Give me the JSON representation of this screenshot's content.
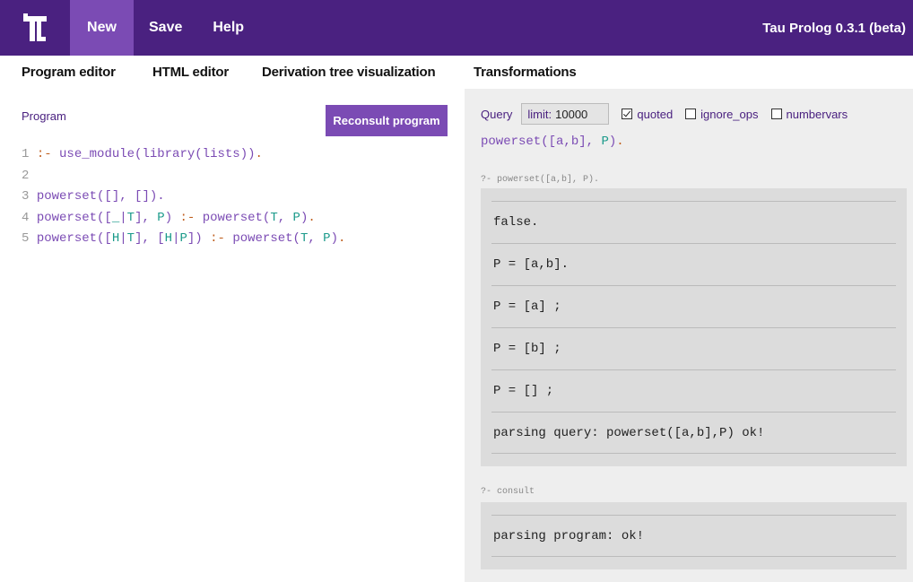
{
  "app": {
    "brand": "Tau Prolog 0.3.1 (beta)",
    "logo_icon": "tau-logo-icon",
    "colors": {
      "header": "#4a2180",
      "accent": "#7b4bb4",
      "variable": "#1a9a8a",
      "operator": "#c06020"
    }
  },
  "menu": {
    "items": [
      {
        "label": "New"
      },
      {
        "label": "Save"
      },
      {
        "label": "Help"
      }
    ]
  },
  "tabs": [
    {
      "label": "Program editor",
      "active": true
    },
    {
      "label": "HTML editor"
    },
    {
      "label": "Derivation tree visualization"
    },
    {
      "label": "Transformations"
    }
  ],
  "program": {
    "label": "Program",
    "reconsult_label": "Reconsult program",
    "lines": [
      {
        "num": "1",
        "tokens": [
          {
            "t": ":-",
            "c": "o"
          },
          {
            "t": " ",
            "c": ""
          },
          {
            "t": "use_module",
            "c": "p"
          },
          {
            "t": "(",
            "c": "p"
          },
          {
            "t": "library",
            "c": "p"
          },
          {
            "t": "(",
            "c": "p"
          },
          {
            "t": "lists",
            "c": "p"
          },
          {
            "t": "))",
            "c": "p"
          },
          {
            "t": ".",
            "c": "o"
          }
        ]
      },
      {
        "num": "2",
        "tokens": []
      },
      {
        "num": "3",
        "tokens": [
          {
            "t": "powerset",
            "c": "p"
          },
          {
            "t": "([], []).",
            "c": "p"
          }
        ]
      },
      {
        "num": "4",
        "tokens": [
          {
            "t": "powerset",
            "c": "p"
          },
          {
            "t": "([",
            "c": "p"
          },
          {
            "t": "_",
            "c": "v"
          },
          {
            "t": "|",
            "c": "p"
          },
          {
            "t": "T",
            "c": "v"
          },
          {
            "t": "], ",
            "c": "p"
          },
          {
            "t": "P",
            "c": "v"
          },
          {
            "t": ") ",
            "c": "p"
          },
          {
            "t": ":-",
            "c": "o"
          },
          {
            "t": " powerset(",
            "c": "p"
          },
          {
            "t": "T",
            "c": "v"
          },
          {
            "t": ", ",
            "c": "p"
          },
          {
            "t": "P",
            "c": "v"
          },
          {
            "t": ")",
            "c": "p"
          },
          {
            "t": ".",
            "c": "o"
          }
        ]
      },
      {
        "num": "5",
        "tokens": [
          {
            "t": "powerset",
            "c": "p"
          },
          {
            "t": "([",
            "c": "p"
          },
          {
            "t": "H",
            "c": "v"
          },
          {
            "t": "|",
            "c": "p"
          },
          {
            "t": "T",
            "c": "v"
          },
          {
            "t": "], [",
            "c": "p"
          },
          {
            "t": "H",
            "c": "v"
          },
          {
            "t": "|",
            "c": "p"
          },
          {
            "t": "P",
            "c": "v"
          },
          {
            "t": "]) ",
            "c": "p"
          },
          {
            "t": ":-",
            "c": "o"
          },
          {
            "t": " powerset(",
            "c": "p"
          },
          {
            "t": "T",
            "c": "v"
          },
          {
            "t": ", ",
            "c": "p"
          },
          {
            "t": "P",
            "c": "v"
          },
          {
            "t": ")",
            "c": "p"
          },
          {
            "t": ".",
            "c": "o"
          }
        ]
      }
    ]
  },
  "query": {
    "label": "Query",
    "limit_label": "limit:",
    "limit_value": "10000",
    "options": [
      {
        "label": "quoted",
        "checked": true
      },
      {
        "label": "ignore_ops",
        "checked": false
      },
      {
        "label": "numbervars",
        "checked": false
      }
    ],
    "input_tokens": [
      {
        "t": "powerset",
        "c": "p"
      },
      {
        "t": "([a,b], ",
        "c": "p"
      },
      {
        "t": "P",
        "c": "v"
      },
      {
        "t": ")",
        "c": "p"
      },
      {
        "t": ".",
        "c": "o"
      }
    ]
  },
  "sessions": [
    {
      "title": "?- powerset([a,b], P).",
      "results": [
        "false.",
        "P = [a,b].",
        "P = [a] ;",
        "P = [b] ;",
        "P = [] ;",
        "parsing query: powerset([a,b],P) ok!"
      ]
    },
    {
      "title": "?- consult",
      "results": [
        "parsing program: ok!"
      ]
    }
  ]
}
